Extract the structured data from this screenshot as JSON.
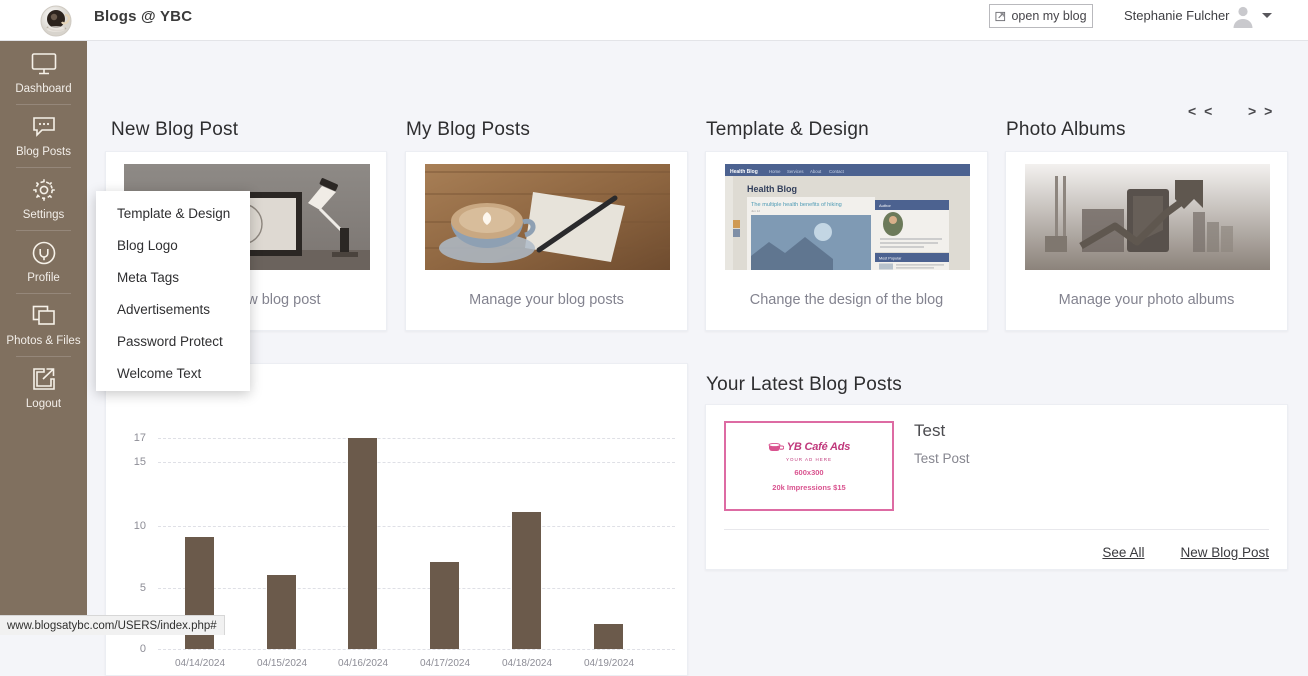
{
  "header": {
    "logo_icon": "coffee-cup-logo",
    "brand_title": "Blogs @ YBC",
    "open_blog_label": "open my blog",
    "open_blog_icon": "external-link-icon",
    "user_name": "Stephanie Fulcher",
    "avatar_icon": "user-avatar-icon",
    "caret_icon": "chevron-down-icon"
  },
  "sidebar": {
    "items": [
      {
        "label": "Dashboard",
        "icon": "monitor-icon"
      },
      {
        "label": "Blog Posts",
        "icon": "comment-icon"
      },
      {
        "label": "Settings",
        "icon": "gear-icon"
      },
      {
        "label": "Profile",
        "icon": "user-circle-icon"
      },
      {
        "label": "Photos & Files",
        "icon": "copy-icon"
      },
      {
        "label": "Logout",
        "icon": "logout-arrow-icon"
      }
    ]
  },
  "pager": {
    "prev": "< <",
    "next": "> >"
  },
  "cards": [
    {
      "title": "New Blog Post",
      "caption": "Create a new blog post",
      "thumb": "desk-frame-lamp-photo"
    },
    {
      "title": "My Blog Posts",
      "caption": "Manage your blog posts",
      "thumb": "coffee-notebook-pen-photo"
    },
    {
      "title": "Template & Design",
      "caption": "Change the design of the blog",
      "thumb": "health-blog-template-preview"
    },
    {
      "title": "Photo Albums",
      "caption": "Manage your photo albums",
      "thumb": "city-chart-graphic"
    }
  ],
  "template_preview": {
    "navbar_brand": "Health Blog",
    "nav_items": [
      "Home",
      "Services",
      "About",
      "Contact"
    ],
    "heading": "Health Blog",
    "post_title": "The multiple health benefits of hiking",
    "sidebar_widget_1": "Author",
    "sidebar_widget_2": "Most Popular"
  },
  "dropdown": {
    "items": [
      "Template & Design",
      "Blog Logo",
      "Meta Tags",
      "Advertisements",
      "Password Protect",
      "Welcome Text"
    ]
  },
  "chart_data": {
    "type": "bar",
    "title": "",
    "xlabel": "",
    "ylabel": "",
    "categories": [
      "04/14/2024",
      "04/15/2024",
      "04/16/2024",
      "04/17/2024",
      "04/18/2024",
      "04/19/2024"
    ],
    "values": [
      9,
      6,
      17,
      7,
      11,
      2
    ],
    "visible_categories": [
      "04/15/2024",
      "04/16/2024",
      "04/17/2024",
      "04/18/2024",
      "04/19/2024"
    ],
    "yticks": [
      0,
      5,
      10,
      15,
      17
    ],
    "ylim": [
      0,
      17
    ],
    "grid": true,
    "legend": "none",
    "bar_color": "#6b5a4b"
  },
  "latest_posts": {
    "title": "Your Latest Blog Posts",
    "posts": [
      {
        "title": "Test",
        "subtitle": "Test Post",
        "thumb": {
          "logo_text": "YB Café Ads",
          "logo_sub": "YOUR AD HERE",
          "size_line": "600x300",
          "price_line": "20k Impressions $15"
        }
      }
    ],
    "links": [
      {
        "label": "See All"
      },
      {
        "label": "New Blog Post"
      }
    ]
  },
  "statusbar": {
    "url": "www.blogsatybc.com/USERS/index.php#"
  },
  "colors": {
    "sidebar": "#80705f",
    "page_bg": "#f4f5f9",
    "bar": "#6b5a4b",
    "accent_pink": "#dd6ba3"
  }
}
